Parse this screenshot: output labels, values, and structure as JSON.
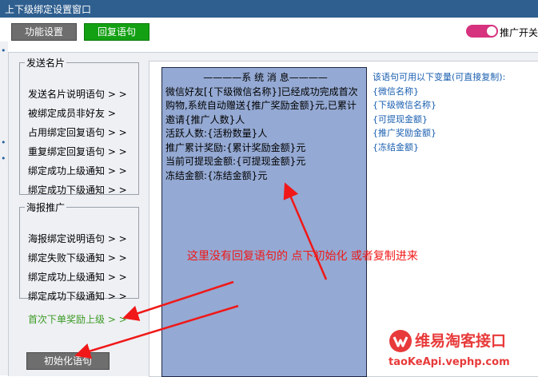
{
  "window": {
    "title": "上下级绑定设置窗口"
  },
  "toolbar": {
    "func_label": "功能设置",
    "reply_label": "回复语句",
    "toggle_label": "推广开关",
    "toggle_on": true
  },
  "groups": [
    {
      "legend": "发送名片",
      "items": [
        "发送名片说明语句 > >",
        "被绑定成员非好友 >",
        "占用绑定回复语句 > >",
        "重复绑定回复语句 > >",
        "绑定成功上级通知 > >",
        "绑定成功下级通知 > >"
      ]
    },
    {
      "legend": "海报推广",
      "items": [
        "海报绑定说明语句 > >",
        "绑定失败下级通知 > >",
        "绑定成功上级通知 > >",
        "绑定成功下级通知 > >"
      ]
    }
  ],
  "first_order_link": "首次下单奖励上级 > >",
  "init_button": "初始化语句",
  "message": {
    "lines": [
      "————系 统 消 息————",
      "微信好友[{下级微信名称}]已经成功完成首次购物,系统自动赠送{推广奖励金额}元,已累计邀请{推广人数}人",
      "活跃人数:{活粉数量}人",
      "推广累计奖励:{累计奖励金额}元",
      "当前可提现金额:{可提现金额}元",
      "冻结金额:{冻结金额}元"
    ]
  },
  "variables": {
    "hint": "该语句可用以下变量(可直接复制):",
    "items": [
      "{微信名称}",
      "{下级微信名称}",
      "{可提现金额}",
      "{推广奖励金额}",
      "{冻结金额}"
    ]
  },
  "annotation": "这里没有回复语句的   点下初始化    或者复制进来",
  "logo": {
    "name": "维易淘客接口",
    "url": "taoKeApi.vephp.com"
  },
  "colors": {
    "titlebar": "#2f5f8f",
    "reply_button": "#13a013",
    "toggle": "#d6327e",
    "message_bg": "#94a9d3",
    "arrow": "#f01818",
    "link_green": "#3c9a24",
    "variable_blue": "#1a5fb0"
  }
}
